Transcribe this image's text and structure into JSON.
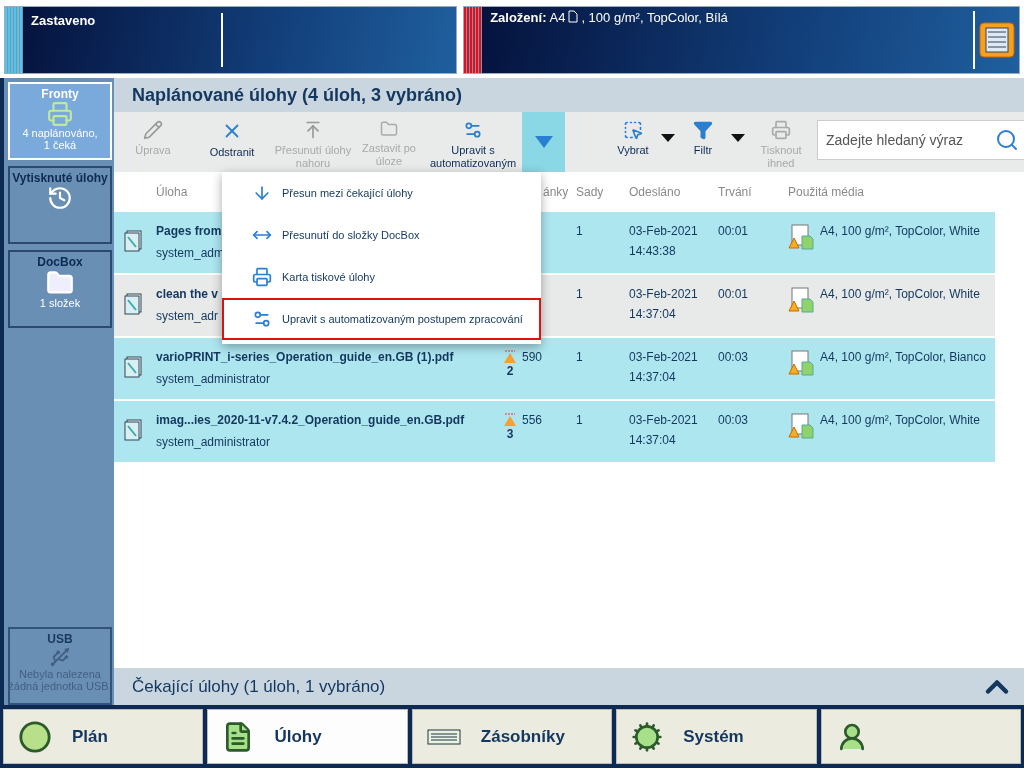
{
  "status_left": {
    "title": "Zastaveno"
  },
  "status_right": {
    "label": "Založení:",
    "size": "A4",
    "media": ", 100 g/m², TopColor, Bílá"
  },
  "sidebar": [
    {
      "kind": "queues",
      "title": "Fronty",
      "lines": [
        "4 naplánováno,",
        "1 čeká"
      ],
      "selected": true,
      "disabled": false
    },
    {
      "kind": "printed",
      "title": "Vytisknuté úlohy",
      "selected": false,
      "disabled": false
    },
    {
      "kind": "docbox",
      "title": "DocBox",
      "lines": [
        "1 složek"
      ],
      "selected": false,
      "disabled": false
    },
    {
      "kind": "usb",
      "title": "USB",
      "lines": [
        "Nebyla nalezena",
        "žádná jednotka USB."
      ],
      "selected": false,
      "disabled": true
    }
  ],
  "header": {
    "title": "Naplánované úlohy (4 úloh, 3 vybráno)"
  },
  "toolbar": [
    {
      "kind": "edit",
      "label": "Úprava",
      "disabled": true
    },
    {
      "kind": "delete",
      "label": "Odstranit",
      "disabled": false
    },
    {
      "kind": "move_up",
      "label": "Přesunutí úlohy nahoru",
      "disabled": true
    },
    {
      "kind": "stop_after",
      "label": "Zastavit po úloze",
      "disabled": true
    },
    {
      "kind": "automate",
      "label": "Upravit s automatizovaným",
      "disabled": false
    }
  ],
  "more_button": {
    "expanded": true
  },
  "toolbar_right": [
    {
      "kind": "select",
      "label": "Vybrat",
      "disabled": false
    },
    {
      "kind": "filter",
      "label": "Filtr",
      "disabled": false
    },
    {
      "kind": "print_now",
      "label": "Tisknout ihned",
      "disabled": true
    }
  ],
  "search": {
    "placeholder": "Zadejte hledaný výraz"
  },
  "columns": [
    "Úloha",
    "ánky",
    "Sady",
    "Odesláno",
    "Trvání",
    "Použitá média"
  ],
  "rows": [
    {
      "name": "Pages from",
      "owner": "system_adm",
      "warnings": "",
      "pages": "",
      "sets": "1",
      "date": "03-Feb-2021",
      "time": "14:43:38",
      "duration": "00:01",
      "media": "A4, 100 g/m², TopColor, White",
      "selected": true
    },
    {
      "name": "clean the v",
      "owner": "system_adr",
      "warnings": "",
      "pages": "",
      "sets": "1",
      "date": "03-Feb-2021",
      "time": "14:37:04",
      "duration": "00:01",
      "media": "A4, 100 g/m², TopColor, White",
      "selected": false
    },
    {
      "name": "varioPRINT_i-series_Operation_guide_en.GB (1).pdf",
      "owner": "system_administrator",
      "warnings": "2",
      "pages": "590",
      "sets": "1",
      "date": "03-Feb-2021",
      "time": "14:37:04",
      "duration": "00:03",
      "media": "A4, 100 g/m², TopColor, Bianco",
      "selected": true
    },
    {
      "name": "imag...ies_2020-11-v7.4.2_Operation_guide_en.GB.pdf",
      "owner": "system_administrator",
      "warnings": "3",
      "pages": "556",
      "sets": "1",
      "date": "03-Feb-2021",
      "time": "14:37:04",
      "duration": "00:03",
      "media": "A4, 100 g/m², TopColor, White",
      "selected": true
    }
  ],
  "menu": [
    {
      "kind": "down",
      "label": "Přesun mezi čekající úlohy",
      "selected": false
    },
    {
      "kind": "swap",
      "label": "Přesunutí do složky DocBox",
      "selected": false
    },
    {
      "kind": "ticket",
      "label": "Karta tiskové úlohy",
      "selected": false
    },
    {
      "kind": "automate",
      "label": "Upravit s automatizovaným postupem zpracování",
      "selected": true
    }
  ],
  "waiting": {
    "title": "Čekající úlohy (1 úloh, 1 vybráno)"
  },
  "nav": [
    {
      "kind": "plan",
      "label": "Plán",
      "selected": false
    },
    {
      "kind": "jobs",
      "label": "Úlohy",
      "selected": true
    },
    {
      "kind": "trays",
      "label": "Zásobníky",
      "selected": false
    },
    {
      "kind": "system",
      "label": "Systém",
      "selected": false
    },
    {
      "kind": "user",
      "selected": false
    }
  ]
}
